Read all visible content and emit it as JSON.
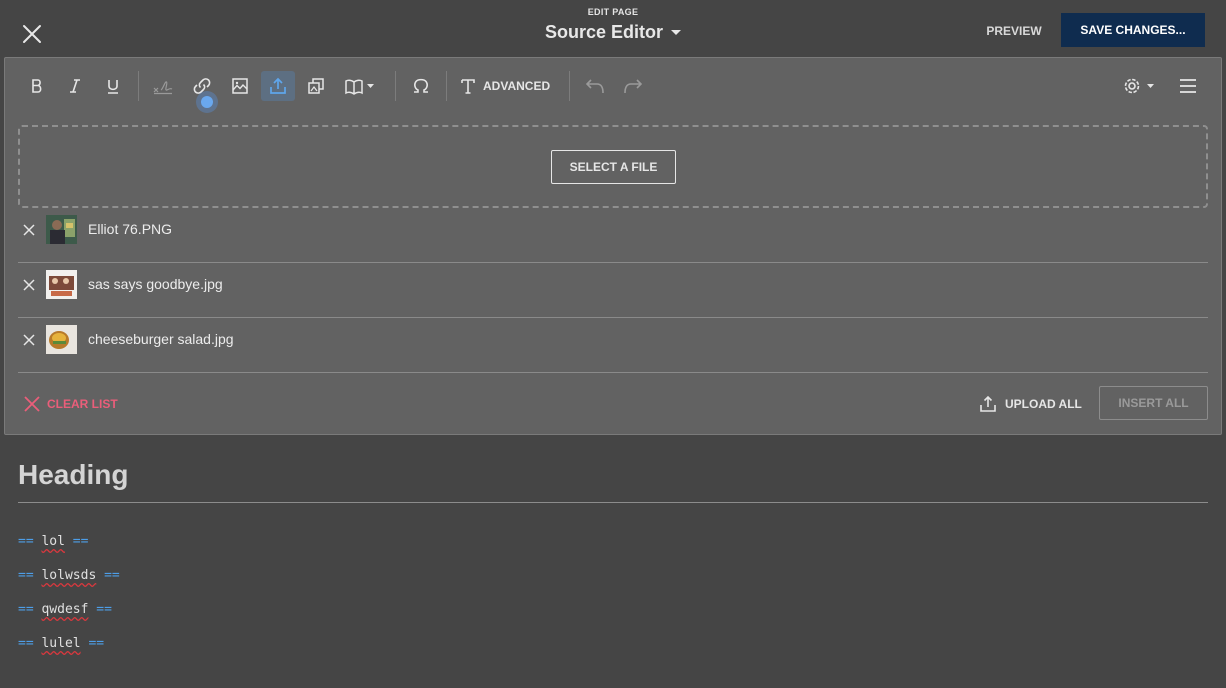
{
  "header": {
    "edit_label": "EDIT PAGE",
    "title": "Source Editor",
    "preview_label": "PREVIEW",
    "save_label": "SAVE CHANGES..."
  },
  "toolbar": {
    "buttons": [
      "bold-icon",
      "italic-icon",
      "underline-icon",
      "signature-icon",
      "link-icon",
      "image-icon",
      "upload-icon",
      "gallery-icon",
      "book-icon",
      "omega-icon",
      "text-icon",
      "undo-icon",
      "redo-icon",
      "gear-icon",
      "menu-icon"
    ],
    "advanced_label": "ADVANCED"
  },
  "upload": {
    "select_label": "SELECT A FILE",
    "files": [
      {
        "name": "Elliot 76.PNG"
      },
      {
        "name": "sas says goodbye.jpg"
      },
      {
        "name": "cheeseburger salad.jpg"
      }
    ],
    "clear_label": "CLEAR LIST",
    "upload_all_label": "UPLOAD ALL",
    "insert_all_label": "INSERT ALL"
  },
  "content": {
    "heading": "Heading",
    "marker": "==",
    "sections": [
      "lol",
      "lolwsds",
      "qwdesf",
      "lulel"
    ]
  },
  "colors": {
    "background": "#454545",
    "panel": "#626262",
    "save_button": "#0f2c4f",
    "clear_list": "#ea5e7a",
    "active_tool": "#5d6f82",
    "wiki_marker": "#4d9ee8"
  }
}
